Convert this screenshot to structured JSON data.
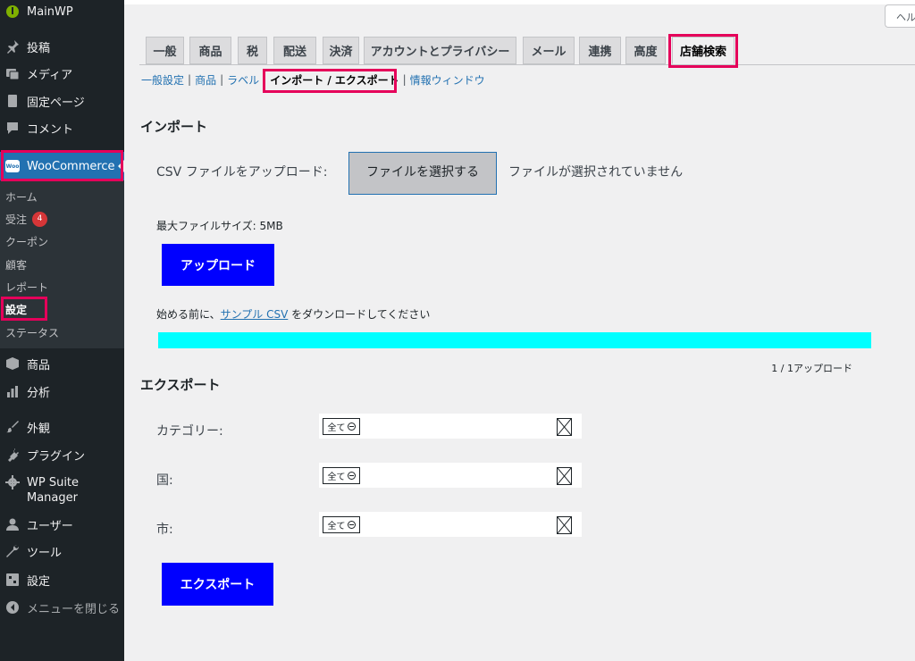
{
  "sidebar": {
    "site_name": "MainWP",
    "items": {
      "posts": "投稿",
      "media": "メディア",
      "pages": "固定ページ",
      "comments": "コメント",
      "woocommerce": "WooCommerce",
      "products": "商品",
      "analytics": "分析",
      "appearance": "外観",
      "plugins": "プラグイン",
      "wp_suite": "WP Suite Manager",
      "users": "ユーザー",
      "tools": "ツール",
      "settings": "設定",
      "collapse": "メニューを閉じる"
    },
    "woo_submenu": {
      "home": "ホーム",
      "orders": "受注",
      "orders_count": "4",
      "coupons": "クーポン",
      "customers": "顧客",
      "reports": "レポート",
      "settings": "設定",
      "status": "ステータス"
    },
    "woo_icon_text": "Woo"
  },
  "header": {
    "help_label": "ヘルプ"
  },
  "tabs": [
    "一般",
    "商品",
    "税",
    "配送",
    "決済",
    "アカウントとプライバシー",
    "メール",
    "連携",
    "高度",
    "店舗検索"
  ],
  "active_tab": "店舗検索",
  "subtabs": [
    "一般設定",
    "商品",
    "ラベル",
    "インポート / エクスポート",
    "情報ウィンドウ"
  ],
  "active_subtab": "インポート / エクスポート",
  "import": {
    "heading": "インポート",
    "csv_label": "CSV ファイルをアップロード:",
    "file_button": "ファイルを選択する",
    "no_file": "ファイルが選択されていません",
    "max_size": "最大ファイルサイズ: 5MB",
    "upload_button": "アップロード",
    "sample_prefix": "始める前に、",
    "sample_link": "サンプル CSV",
    "sample_suffix": "をダウンロードしてください",
    "progress_fraction": 1.0,
    "progress_text": "1 / 1アップロード"
  },
  "export": {
    "heading": "エクスポート",
    "fields": [
      {
        "label": "カテゴリー:",
        "value": "全て"
      },
      {
        "label": "国:",
        "value": "全て"
      },
      {
        "label": "市:",
        "value": "全て"
      }
    ],
    "export_button": "エクスポート"
  },
  "colors": {
    "highlight": "#e5005a",
    "sidebar_bg": "#1d2327",
    "accent": "#2271b1",
    "primary_button": "#0000ff",
    "progress": "#00ffff"
  }
}
